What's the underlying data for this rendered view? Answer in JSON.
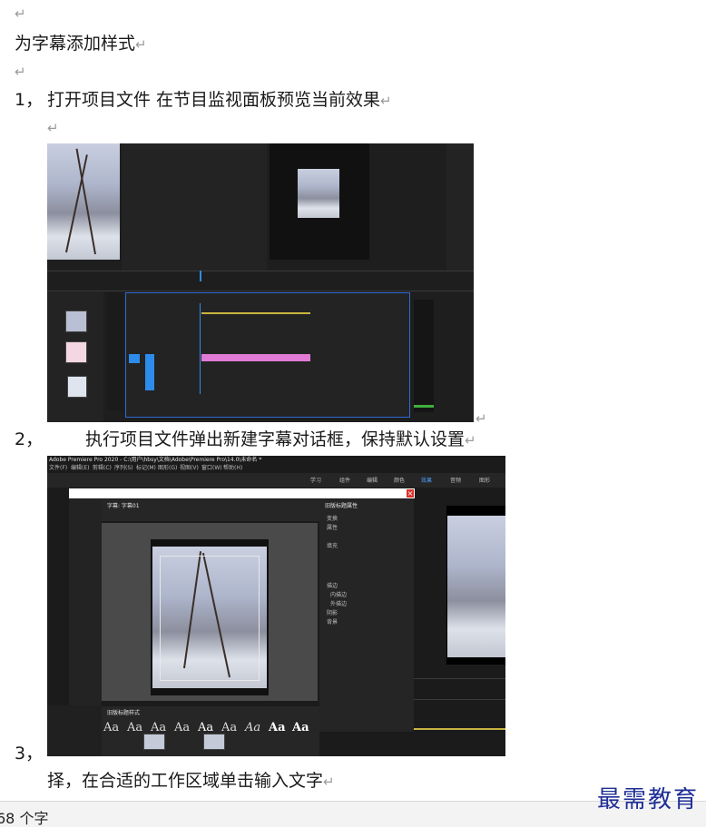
{
  "paragraph_mark": "↵",
  "title": "为字幕添加样式",
  "steps": [
    {
      "num": "1，",
      "text": "打开项目文件  在节目监视面板预览当前效果"
    },
    {
      "num": "2，",
      "text": "执行项目文件弹出新建字幕对话框，保持默认设置"
    },
    {
      "num": "3，",
      "text": "择，在合适的工作区域单击输入文字"
    }
  ],
  "screenshot2": {
    "title_bar": "Adobe Premiere Pro 2020 - C:\\用户\\hbsy\\文档\\Adobe\\Premiere Pro\\14.0\\未命名 *",
    "menu": [
      "文件(F)",
      "编辑(E)",
      "剪辑(C)",
      "序列(S)",
      "标记(M)",
      "图形(G)",
      "视图(V)",
      "窗口(W)",
      "帮助(H)"
    ],
    "workspaces": [
      "学习",
      "组件",
      "编辑",
      "颜色",
      "效果",
      "音频",
      "图形"
    ],
    "title_panel": "字幕: 字幕01",
    "props_panel": "旧版标题属性",
    "props_items": [
      "变换",
      "属性",
      "填充",
      "描边",
      "内描边",
      "外描边",
      "阴影",
      "背景"
    ],
    "styles_panel": "旧版标题样式",
    "aa_label": "Aa"
  },
  "status": {
    "word_count": "68 个字"
  },
  "brand": "最需教育"
}
